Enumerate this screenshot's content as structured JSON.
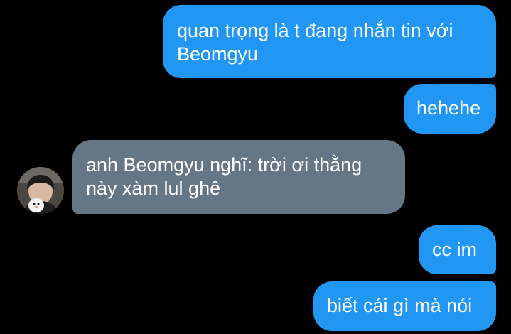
{
  "conversation": {
    "messages": [
      {
        "direction": "outgoing",
        "text": "quan trọng là t đang nhắn tin với\nBeomgyu"
      },
      {
        "direction": "outgoing",
        "text": "hehehe"
      },
      {
        "direction": "incoming",
        "text": "anh Beomgyu nghĩ: trời ơi thằng\nnày xàm lul ghê"
      },
      {
        "direction": "outgoing",
        "text": "cc im"
      },
      {
        "direction": "outgoing",
        "text": "biết cái gì mà nói"
      }
    ],
    "colors": {
      "background": "#000000",
      "outgoing_bubble": "#2196f3",
      "incoming_bubble": "#657786",
      "text": "#ffffff"
    },
    "contact_avatar": "contact-avatar-photo"
  }
}
